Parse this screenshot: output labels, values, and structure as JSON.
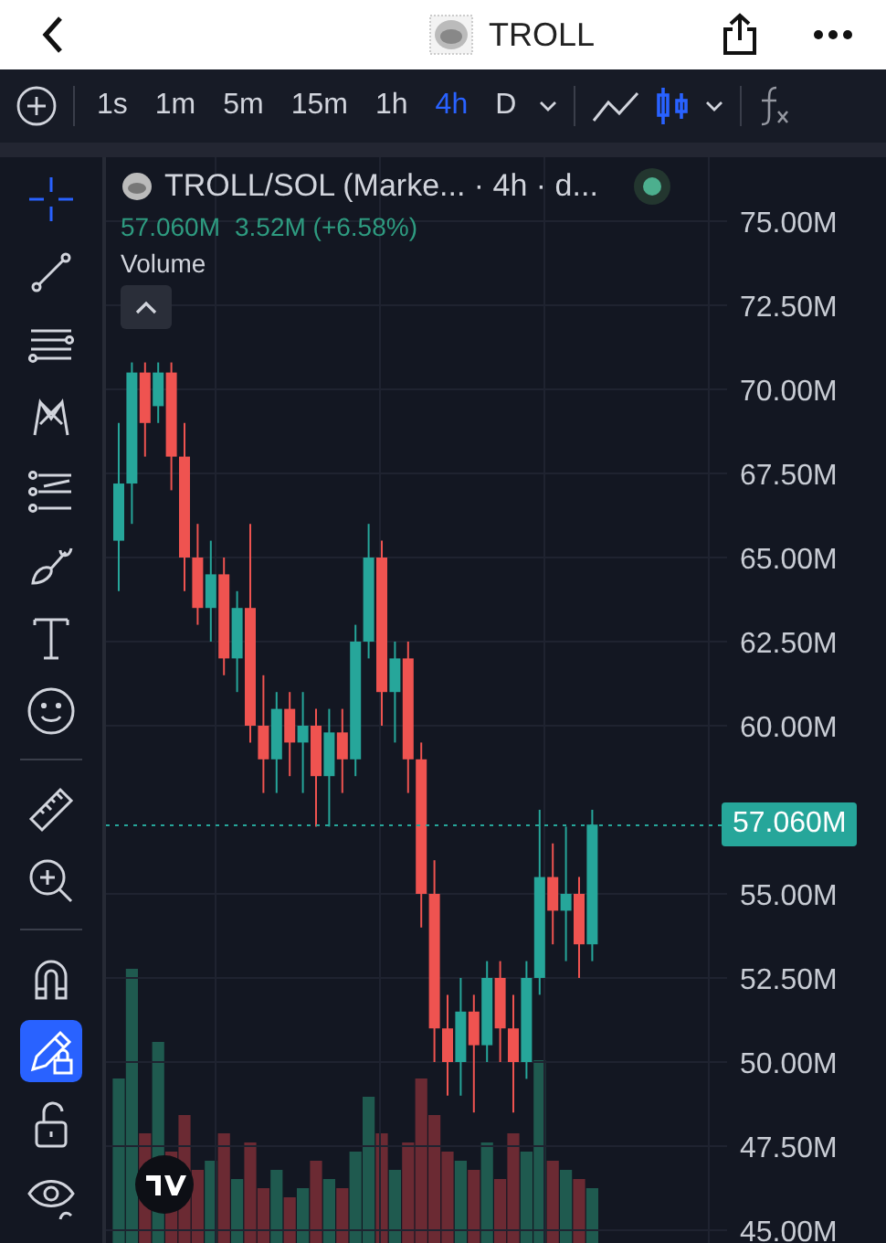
{
  "header": {
    "title": "TROLL"
  },
  "toolbar": {
    "timeframes": [
      {
        "label": "1s",
        "selected": false
      },
      {
        "label": "1m",
        "selected": false
      },
      {
        "label": "5m",
        "selected": false
      },
      {
        "label": "15m",
        "selected": false
      },
      {
        "label": "1h",
        "selected": false
      },
      {
        "label": "4h",
        "selected": true
      },
      {
        "label": "D",
        "selected": false
      }
    ],
    "chart_styles": [
      {
        "kind": "line",
        "selected": false
      },
      {
        "kind": "candles",
        "selected": true
      }
    ]
  },
  "drawing_tools": [
    [
      {
        "kind": "crosshair",
        "selected": true
      },
      {
        "kind": "trend-line",
        "selected": false
      },
      {
        "kind": "fib",
        "selected": false
      },
      {
        "kind": "pattern",
        "selected": false
      },
      {
        "kind": "forecast",
        "selected": false
      },
      {
        "kind": "brush",
        "selected": false
      },
      {
        "kind": "text",
        "selected": false
      },
      {
        "kind": "emoji",
        "selected": false
      }
    ],
    [
      {
        "kind": "ruler",
        "selected": false
      },
      {
        "kind": "zoom",
        "selected": false
      }
    ],
    [
      {
        "kind": "magnet",
        "selected": false
      },
      {
        "kind": "pencil-lock",
        "selected": true
      },
      {
        "kind": "lock",
        "selected": false
      },
      {
        "kind": "eye",
        "selected": false
      }
    ]
  ],
  "legend": {
    "symbol": "TROLL/SOL (Marke... · 4h · d...",
    "price": "57.060M",
    "change": "3.52M (+6.58%)",
    "indicator": "Volume"
  },
  "chart": {
    "current_price": "57.060M",
    "chart_data": {
      "type": "candlestick",
      "ylim": [
        45,
        75
      ],
      "grid": true,
      "yticks": [
        {
          "value": 75,
          "label": "75.00M"
        },
        {
          "value": 72.5,
          "label": "72.50M"
        },
        {
          "value": 70,
          "label": "70.00M"
        },
        {
          "value": 67.5,
          "label": "67.50M"
        },
        {
          "value": 65,
          "label": "65.00M"
        },
        {
          "value": 62.5,
          "label": "62.50M"
        },
        {
          "value": 60,
          "label": "60.00M"
        },
        {
          "value": 55,
          "label": "55.00M"
        },
        {
          "value": 52.5,
          "label": "52.50M"
        },
        {
          "value": 50,
          "label": "50.00M"
        },
        {
          "value": 47.5,
          "label": "47.50M"
        },
        {
          "value": 45,
          "label": "45.00M"
        }
      ],
      "ohlc": [
        [
          65.5,
          69,
          64,
          67.2
        ],
        [
          67.2,
          70.8,
          66,
          70.5
        ],
        [
          70.5,
          70.8,
          68,
          69
        ],
        [
          69.5,
          70.8,
          69,
          70.5
        ],
        [
          70.5,
          70.8,
          67,
          68
        ],
        [
          68,
          69,
          64,
          65
        ],
        [
          65,
          66,
          63,
          63.5
        ],
        [
          63.5,
          65.5,
          62.5,
          64.5
        ],
        [
          64.5,
          65,
          61.5,
          62
        ],
        [
          62,
          64,
          61,
          63.5
        ],
        [
          63.5,
          66,
          59.5,
          60
        ],
        [
          60,
          61.5,
          58,
          59
        ],
        [
          59,
          61,
          58,
          60.5
        ],
        [
          60.5,
          61,
          58.5,
          59.5
        ],
        [
          59.5,
          61,
          58,
          60
        ],
        [
          60,
          60.5,
          57,
          58.5
        ],
        [
          58.5,
          60.5,
          57,
          59.8
        ],
        [
          59.8,
          60.5,
          58,
          59
        ],
        [
          59,
          63,
          58.5,
          62.5
        ],
        [
          62.5,
          66,
          62,
          65
        ],
        [
          65,
          65.5,
          60,
          61
        ],
        [
          61,
          62.5,
          59.5,
          62
        ],
        [
          62,
          62.5,
          58,
          59
        ],
        [
          59,
          59.5,
          54,
          55
        ],
        [
          55,
          56,
          50,
          51
        ],
        [
          51,
          52,
          49,
          50
        ],
        [
          50,
          52.5,
          49,
          51.5
        ],
        [
          51.5,
          52,
          48.5,
          50.5
        ],
        [
          50.5,
          53,
          50,
          52.5
        ],
        [
          52.5,
          53,
          50,
          51
        ],
        [
          51,
          52,
          48.5,
          50
        ],
        [
          50,
          53,
          49.5,
          52.5
        ],
        [
          52.5,
          57.5,
          52,
          55.5
        ],
        [
          55.5,
          56.5,
          53.5,
          54.5
        ],
        [
          54.5,
          57,
          53,
          55
        ],
        [
          55,
          55.5,
          52.5,
          53.5
        ],
        [
          53.5,
          57.5,
          53,
          57.06
        ]
      ]
    }
  }
}
